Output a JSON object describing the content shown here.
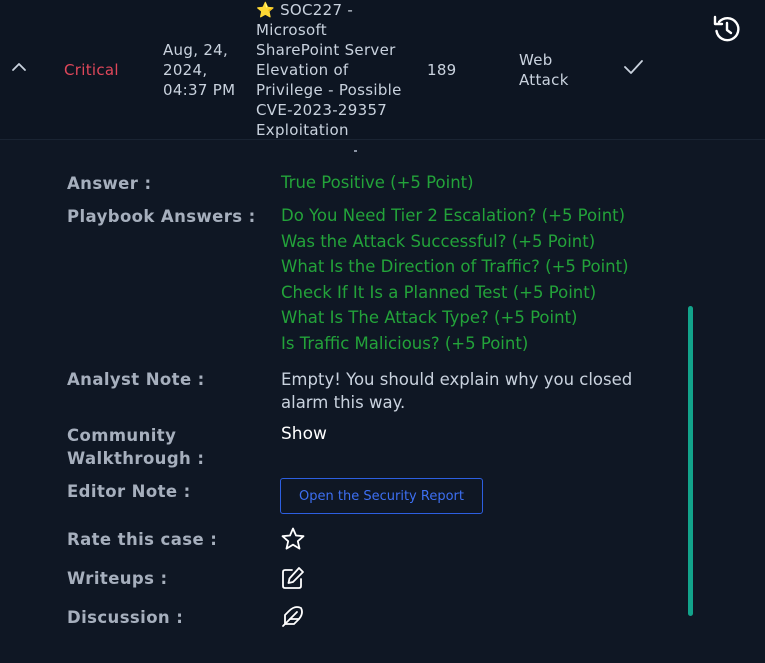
{
  "alert": {
    "severity": "Critical",
    "date_line1": "Aug, 24,",
    "date_line2": "2024,",
    "date_line3": "04:37 PM",
    "title_lines": [
      "SOC227 -",
      "Microsoft",
      "SharePoint Server",
      "Elevation of",
      "Privilege - Possible",
      "CVE-2023-29357",
      "Exploitation"
    ],
    "event_id": "189",
    "type_line1": "Web",
    "type_line2": "Attack"
  },
  "details": {
    "answer_label": "Answer :",
    "answer_value": "True Positive (+5 Point)",
    "playbook_label": "Playbook Answers :",
    "playbook_answers": [
      "Do You Need Tier 2 Escalation? (+5 Point)",
      "Was the Attack Successful? (+5 Point)",
      "What Is the Direction of Traffic? (+5 Point)",
      "Check If It Is a Planned Test (+5 Point)",
      "What Is The Attack Type? (+5 Point)",
      "Is Traffic Malicious? (+5 Point)"
    ],
    "analyst_note_label": "Analyst Note :",
    "analyst_note_line1": "Empty! You should explain why you closed",
    "analyst_note_line2": "alarm this way.",
    "community_label_line1": "Community",
    "community_label_line2": "Walkthrough :",
    "community_show": "Show",
    "editor_note_label": "Editor Note :",
    "report_button": "Open the Security Report",
    "rate_label": "Rate this case :",
    "writeups_label": "Writeups :",
    "discussion_label": "Discussion :"
  },
  "colors": {
    "background": "#0f1724",
    "critical": "#e0475a",
    "green_text": "#23a33a",
    "button_blue": "#2d5fe0",
    "scrollbar": "#12a38b"
  },
  "icons": {
    "collapse": "chevron-up-icon",
    "star_title": "star-icon",
    "check": "check-icon",
    "restore": "restore-icon",
    "rate": "star-outline-icon",
    "writeups": "edit-icon",
    "discussion": "feather-icon"
  }
}
